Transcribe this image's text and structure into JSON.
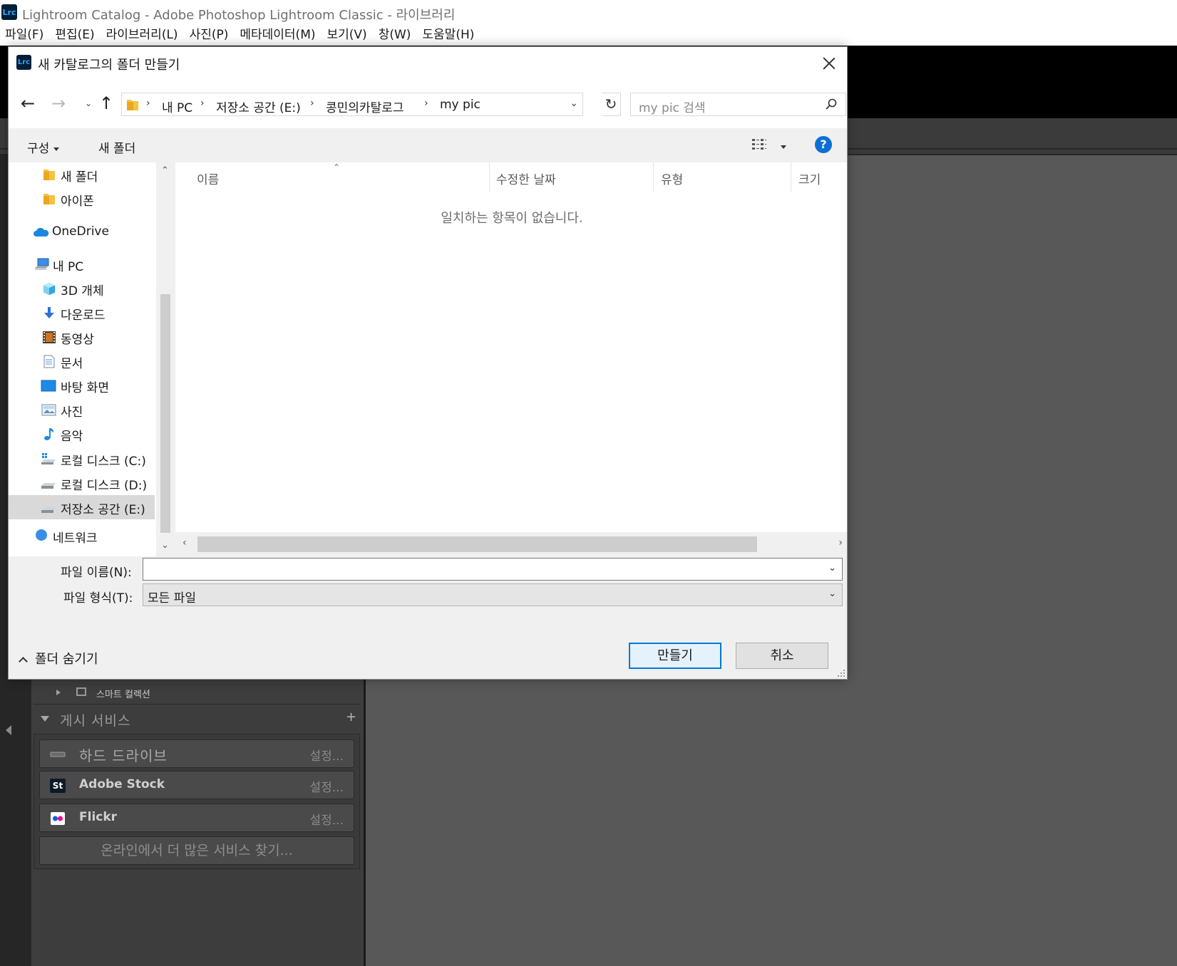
{
  "app": {
    "logo_text": "Lrc",
    "title": "Lightroom Catalog - Adobe Photoshop Lightroom Classic - 라이브러리",
    "menu": [
      "파일(F)",
      "편집(E)",
      "라이브러리(L)",
      "사진(P)",
      "메타데이터(M)",
      "보기(V)",
      "창(W)",
      "도움말(H)"
    ]
  },
  "lr_panel": {
    "smart_collection": "스마트 컬렉션",
    "publish_services": "게시 서비스",
    "add_icon": "+",
    "services": [
      {
        "name": "하드 드라이브",
        "action": "설정...",
        "icon": "hard-drive-icon"
      },
      {
        "name": "Adobe Stock",
        "action": "설정...",
        "icon": "adobe-stock-icon",
        "icon_text": "St"
      },
      {
        "name": "Flickr",
        "action": "설정...",
        "icon": "flickr-icon"
      }
    ],
    "find_more": "온라인에서 더 많은 서비스 찾기..."
  },
  "dialog": {
    "title": "새 카탈로그의 폴더 만들기",
    "breadcrumb": [
      "내 PC",
      "저장소 공간 (E:)",
      "콩민의카탈로그",
      "my pic"
    ],
    "search_placeholder": "my pic 검색",
    "toolbar": {
      "organize": "구성",
      "new_folder": "새 폴더",
      "help": "?"
    },
    "tree": [
      {
        "label": "새 폴더",
        "icon": "folder-icon"
      },
      {
        "label": "아이폰",
        "icon": "folder-icon"
      },
      {
        "label": "OneDrive",
        "icon": "onedrive-icon"
      },
      {
        "label": "내 PC",
        "icon": "pc-icon"
      },
      {
        "label": "3D 개체",
        "icon": "3d-objects-icon"
      },
      {
        "label": "다운로드",
        "icon": "download-icon"
      },
      {
        "label": "동영상",
        "icon": "video-icon"
      },
      {
        "label": "문서",
        "icon": "document-icon"
      },
      {
        "label": "바탕 화면",
        "icon": "desktop-icon"
      },
      {
        "label": "사진",
        "icon": "pictures-icon"
      },
      {
        "label": "음악",
        "icon": "music-icon"
      },
      {
        "label": "로컬 디스크 (C:)",
        "icon": "windows-drive-icon"
      },
      {
        "label": "로컬 디스크 (D:)",
        "icon": "drive-icon"
      },
      {
        "label": "저장소 공간 (E:)",
        "icon": "drive-icon",
        "selected": true
      },
      {
        "label": "네트워크",
        "icon": "network-icon"
      }
    ],
    "columns": [
      "이름",
      "수정한 날짜",
      "유형",
      "크기"
    ],
    "empty_message": "일치하는 항목이 없습니다.",
    "filename_label": "파일 이름(N):",
    "filename_value": "",
    "filetype_label": "파일 형식(T):",
    "filetype_value": "모든 파일",
    "hide_folders": "폴더 숨기기",
    "create_button": "만들기",
    "cancel_button": "취소"
  }
}
